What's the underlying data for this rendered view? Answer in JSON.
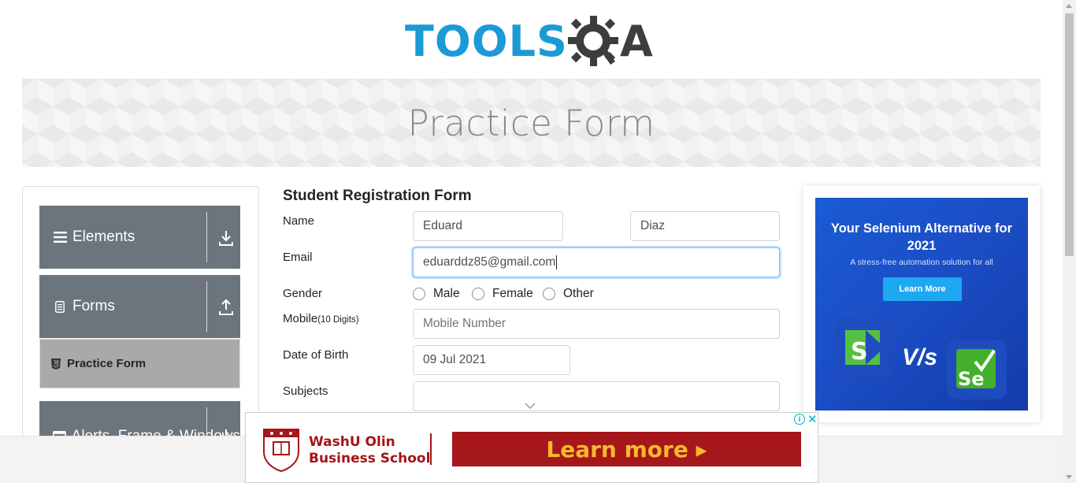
{
  "logo": {
    "text_left": "TOOLS",
    "text_right": "A"
  },
  "banner": {
    "title": "Practice Form"
  },
  "sidebar": {
    "groups": [
      {
        "label": "Elements",
        "icon": "hamburger-icon",
        "arrow": "download-icon"
      },
      {
        "label": "Forms",
        "icon": "document-icon",
        "arrow": "upload-icon"
      },
      {
        "label": "Alerts, Frame & Windows",
        "icon": "browser-window-icon",
        "arrow": "download-icon"
      }
    ],
    "active_item": {
      "label": "Practice Form",
      "icon": "html5-icon"
    }
  },
  "form": {
    "title": "Student Registration Form",
    "name_label": "Name",
    "first_name_value": "Eduard",
    "last_name_value": "Diaz",
    "email_label": "Email",
    "email_value": "eduarddz85@gmail.com",
    "gender_label": "Gender",
    "gender_options": [
      "Male",
      "Female",
      "Other"
    ],
    "mobile_label": "Mobile",
    "mobile_hint": "(10 Digits)",
    "mobile_placeholder": "Mobile Number",
    "dob_label": "Date of Birth",
    "dob_value": "09 Jul 2021",
    "subjects_label": "Subjects",
    "subjects_value": ""
  },
  "ad_right": {
    "headline": "Your Selenium Alternative for 2021",
    "subline": "A stress-free automation solution for all",
    "button": "Learn More",
    "vs_text": "V/s",
    "left_logo_letter": "S",
    "right_logo_text": "Se"
  },
  "ad_bottom": {
    "school_line1": "WashU Olin",
    "school_line2": "Business School",
    "cta": "Learn more ▸",
    "colors": {
      "brand": "#a5171a",
      "cta_text": "#f6b82d"
    }
  },
  "colors": {
    "sidebar_header": "#6c757d",
    "active_item": "#a9a9a9",
    "logo_blue": "#1b9ad6",
    "logo_dark": "#3d3d3d"
  }
}
